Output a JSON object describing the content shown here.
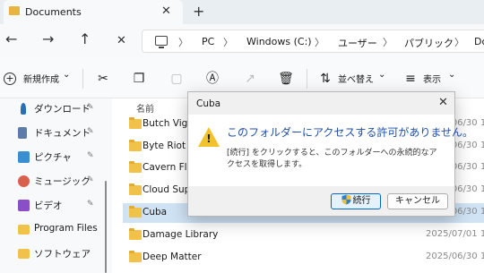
{
  "window": {
    "tab_title": "Documents",
    "new_tab": "+",
    "close_tab": "✕"
  },
  "nav": {
    "back": "←",
    "forward": "→",
    "up": "↑",
    "close": "✕"
  },
  "address": {
    "crumbs": [
      "PC",
      "Windows (C:)",
      "ユーザー",
      "パブリック",
      "Do"
    ],
    "separator": "〉"
  },
  "toolbar": {
    "new_label": "新規作成",
    "new_chevron": "⌄",
    "sort_label": "並べ替え",
    "sort_chevron": "⌄",
    "view_label": "表示",
    "view_chevron": "⌄"
  },
  "sidebar": {
    "items": [
      {
        "label": "ダウンロード",
        "icon": "download-icon",
        "color": "#2a6fb3",
        "pinned": true
      },
      {
        "label": "ドキュメント",
        "icon": "document-icon",
        "color": "#5b7da8",
        "pinned": true
      },
      {
        "label": "ピクチャ",
        "icon": "pictures-icon",
        "color": "#3b8fd0",
        "pinned": true
      },
      {
        "label": "ミュージック",
        "icon": "music-icon",
        "color": "#d9604c",
        "pinned": true
      },
      {
        "label": "ビデオ",
        "icon": "video-icon",
        "color": "#8a4fc6",
        "pinned": true
      },
      {
        "label": "Program Files",
        "icon": "folder-icon",
        "color": "#f0c24a",
        "pinned": false
      },
      {
        "label": "ソフトウェア",
        "icon": "folder-icon",
        "color": "#f0c24a",
        "pinned": false
      }
    ],
    "pin_glyph": "📌"
  },
  "files": {
    "column_name": "名前",
    "rows": [
      {
        "name": "Butch Vig",
        "date": "2025/06/30 1",
        "selected": false
      },
      {
        "name": "Byte Riot",
        "date": "2025/06/30 1",
        "selected": false
      },
      {
        "name": "Cavern Fl",
        "date": "2025/06/30 1",
        "selected": false
      },
      {
        "name": "Cloud Sup",
        "date": "2025/06/30 1",
        "selected": false
      },
      {
        "name": "Cuba",
        "date": "2025/06/30 1",
        "selected": true
      },
      {
        "name": "Damage Library",
        "date": "2025/07/01 1",
        "selected": false
      },
      {
        "name": "Deep Matter",
        "date": "2025/06/30 1",
        "selected": false
      }
    ]
  },
  "dialog": {
    "title": "Cuba",
    "close": "✕",
    "message": "このフォルダーにアクセスする許可がありません。",
    "detail": "[続行] をクリックすると、このフォルダーへの永続的なアクセスを取得します。",
    "continue_label": "続行",
    "cancel_label": "キャンセル",
    "warning_mark": "!"
  },
  "colors": {
    "accent": "#0067c0",
    "selection": "#cfe3f5",
    "folder": "#f0c24a",
    "warning": "#f2c12e",
    "dialog_text": "#1f4ea8"
  }
}
